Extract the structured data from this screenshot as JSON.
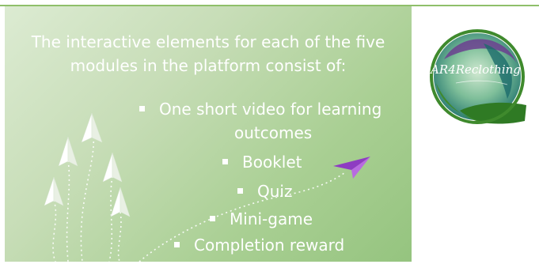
{
  "slide": {
    "heading_line1": "The interactive elements for each of the five",
    "heading_line2": "modules in the platform consist of:",
    "bullets": [
      {
        "line1": "One short video for learning",
        "line2": "outcomes"
      },
      {
        "line1": "Booklet"
      },
      {
        "line1": "Quiz"
      },
      {
        "line1": "Mini-game"
      },
      {
        "line1": "Completion reward"
      }
    ]
  },
  "logo": {
    "text": "AR4Reclothing",
    "colors": {
      "green": "#3f8a2d",
      "teal": "#1c6b6b",
      "purple": "#6b3f8f",
      "light": "#cfe8c8"
    }
  },
  "icons": [
    "paper-plane-icon",
    "paper-plane-icon-purple"
  ],
  "colors": {
    "panel": "#b3d6a0",
    "text": "#ffffff",
    "accent": "#9b3fc8"
  }
}
